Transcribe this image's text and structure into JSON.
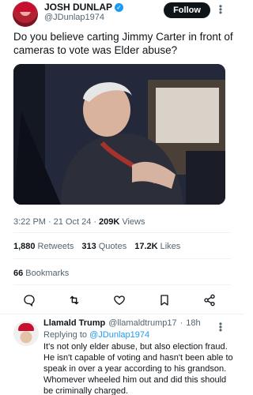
{
  "post": {
    "author_name": "JOSH DUNLAP",
    "author_handle": "@JDunlap1974",
    "follow_label": "Follow",
    "more_label": "⋮",
    "text": "Do you believe carting Jimmy Carter in front of cameras to vote was Elder abuse?",
    "time": "3:22 PM",
    "date": "21 Oct 24",
    "views_count": "209K",
    "views_label": "Views",
    "retweets_count": "1,880",
    "retweets_label": "Retweets",
    "quotes_count": "313",
    "quotes_label": "Quotes",
    "likes_count": "17.2K",
    "likes_label": "Likes",
    "bookmarks_count": "66",
    "bookmarks_label": "Bookmarks"
  },
  "actions": [
    "reply-icon",
    "retweet-icon",
    "like-icon",
    "bookmark-icon",
    "share-icon"
  ],
  "reply": {
    "author_name": "Llamald Trump",
    "author_handle": "@llamaldtrump17",
    "age": "18h",
    "more_label": "⋮",
    "replying_prefix": "Replying to",
    "replying_to": "@JDunlap1974",
    "text": "It's not only elder abuse, but also election fraud. He isn't capable of voting and hasn't been able to speak in over a year according to his grandson. Whomever wheeled him out and did this should be criminally charged."
  },
  "colors": {
    "accent": "#1d9bf0",
    "text": "#0f1419",
    "muted": "#536471"
  }
}
